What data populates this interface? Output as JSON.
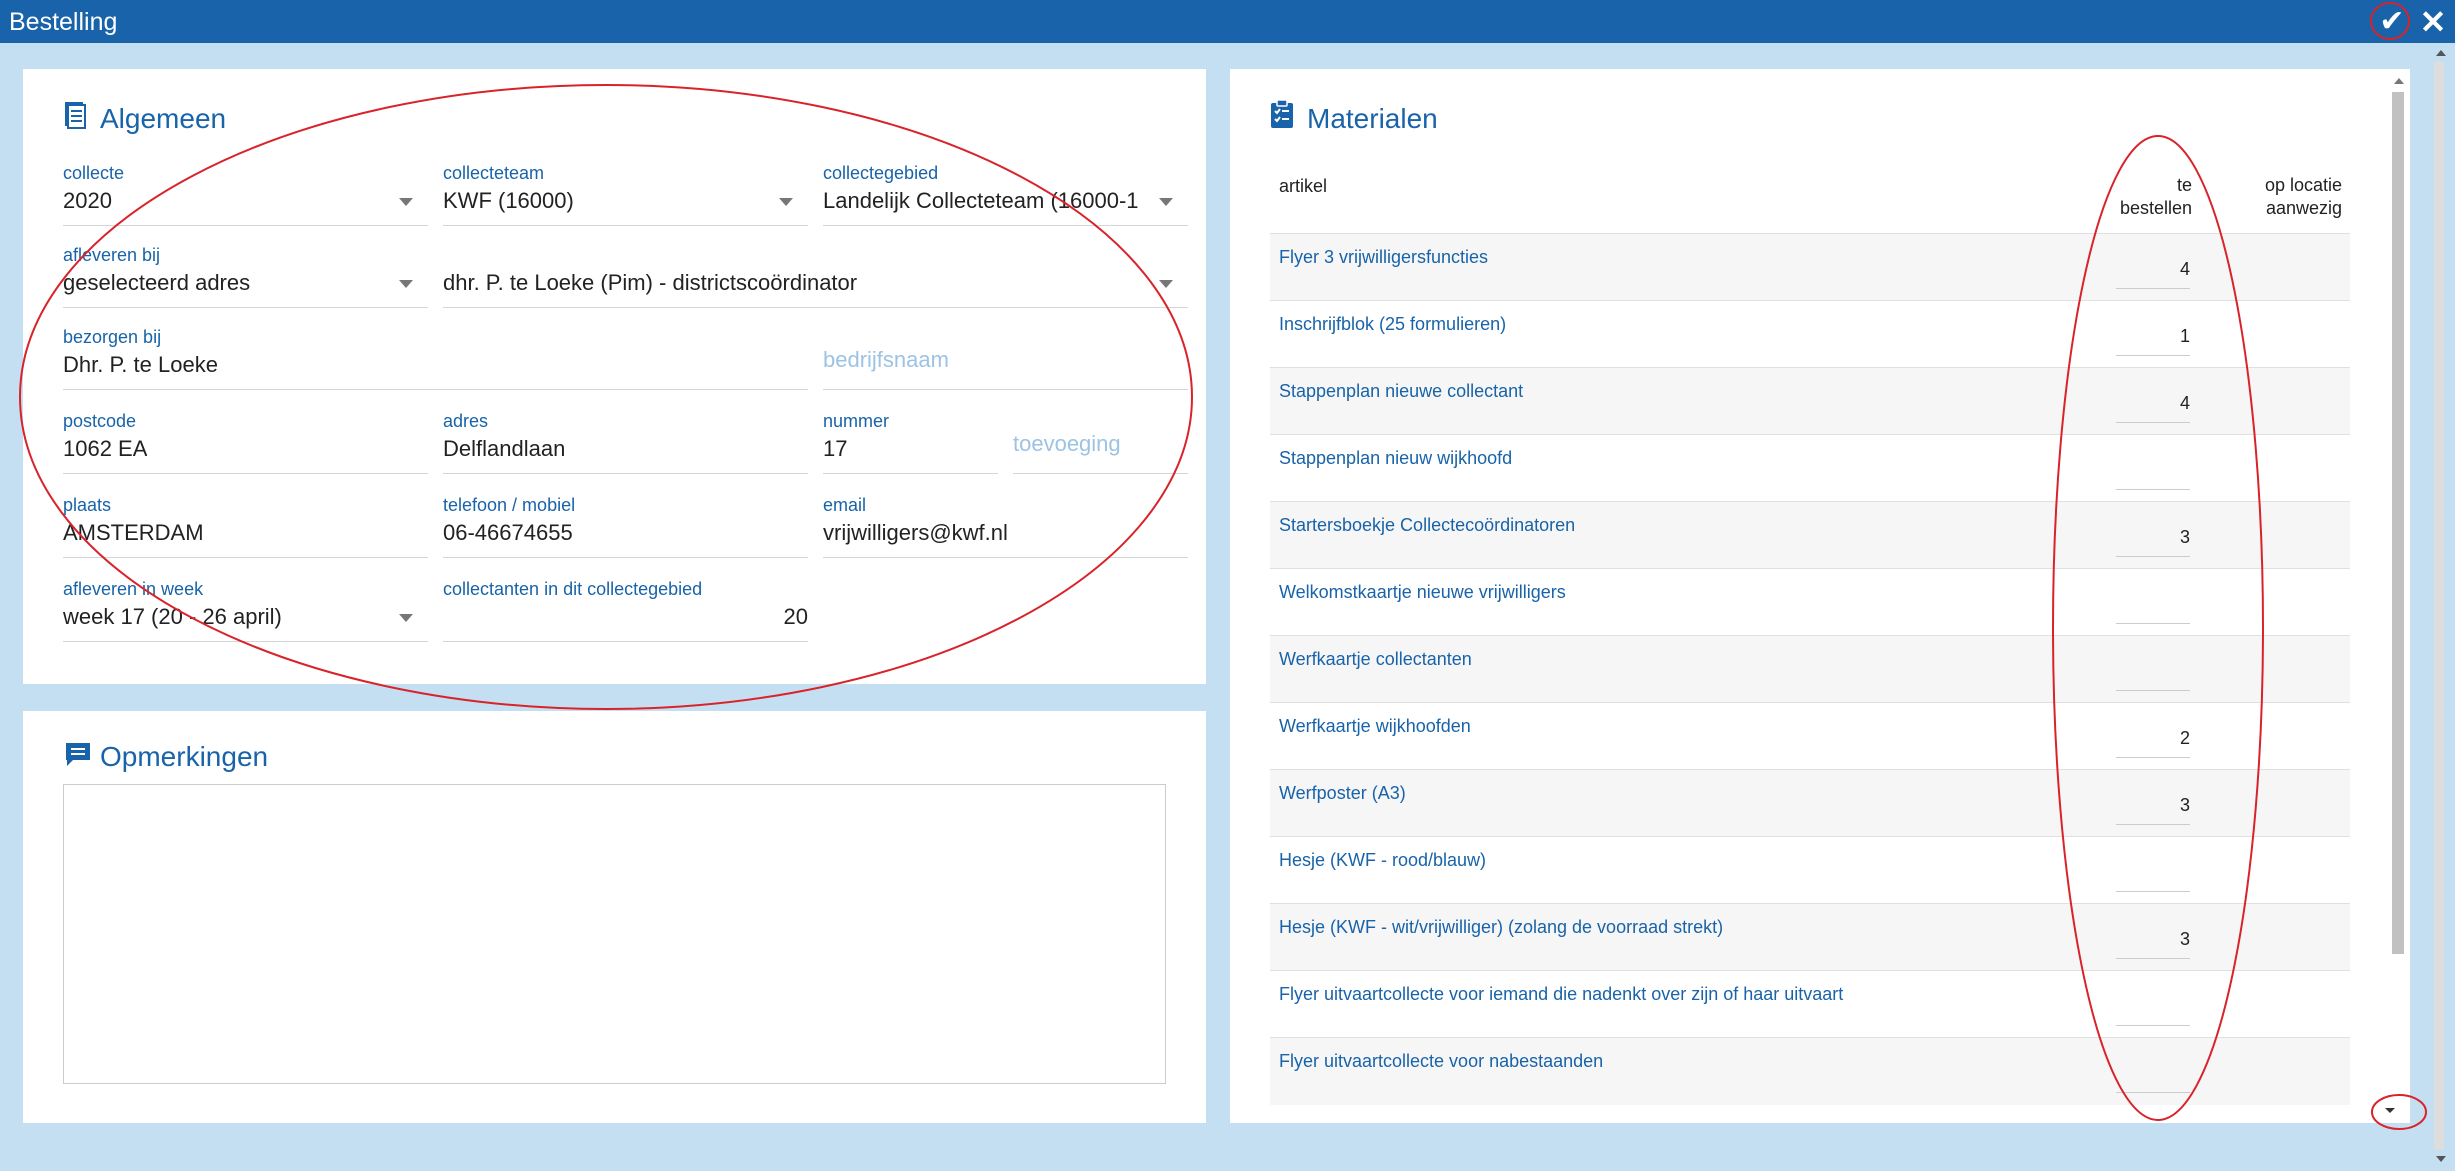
{
  "window": {
    "title": "Bestelling",
    "confirm_icon": "check-icon",
    "close_icon": "close-icon"
  },
  "algemeen": {
    "title": "Algemeen",
    "icon": "document-icon",
    "collecte": {
      "label": "collecte",
      "value": "2020"
    },
    "collecteteam": {
      "label": "collecteteam",
      "value": "KWF (16000)"
    },
    "collectegebied": {
      "label": "collectegebied",
      "value": "Landelijk Collecteteam (16000-1"
    },
    "afleveren_bij": {
      "label": "afleveren bij",
      "value": "geselecteerd adres"
    },
    "contact": {
      "value": "dhr. P. te Loeke (Pim) - districtscoördinator"
    },
    "bezorgen_bij": {
      "label": "bezorgen bij",
      "value": "Dhr. P. te Loeke"
    },
    "bedrijfsnaam": {
      "placeholder": "bedrijfsnaam"
    },
    "postcode": {
      "label": "postcode",
      "value": "1062 EA"
    },
    "adres": {
      "label": "adres",
      "value": "Delflandlaan"
    },
    "nummer": {
      "label": "nummer",
      "value": "17"
    },
    "toevoeging": {
      "placeholder": "toevoeging"
    },
    "plaats": {
      "label": "plaats",
      "value": "AMSTERDAM"
    },
    "telefoon": {
      "label": "telefoon / mobiel",
      "value": "06-46674655"
    },
    "email": {
      "label": "email",
      "value": "vrijwilligers@kwf.nl"
    },
    "afleveren_week": {
      "label": "afleveren in week",
      "value": "week 17 (20 - 26 april)"
    },
    "collectanten": {
      "label": "collectanten in dit collectegebied",
      "value": "20"
    }
  },
  "opmerkingen": {
    "title": "Opmerkingen",
    "icon": "comment-icon",
    "text": ""
  },
  "materialen": {
    "title": "Materialen",
    "icon": "clipboard-check-icon",
    "headers": {
      "artikel": "artikel",
      "te_bestellen_1": "te",
      "te_bestellen_2": "bestellen",
      "op_locatie_1": "op locatie",
      "op_locatie_2": "aanwezig"
    },
    "rows": [
      {
        "name": "Flyer 3 vrijwilligersfuncties",
        "qty": "4"
      },
      {
        "name": "Inschrijfblok (25 formulieren)",
        "qty": "1"
      },
      {
        "name": "Stappenplan nieuwe collectant",
        "qty": "4"
      },
      {
        "name": "Stappenplan nieuw wijkhoofd",
        "qty": ""
      },
      {
        "name": "Startersboekje Collectecoördinatoren",
        "qty": "3"
      },
      {
        "name": "Welkomstkaartje nieuwe vrijwilligers",
        "qty": ""
      },
      {
        "name": "Werfkaartje collectanten",
        "qty": ""
      },
      {
        "name": "Werfkaartje wijkhoofden",
        "qty": "2"
      },
      {
        "name": "Werfposter (A3)",
        "qty": "3"
      },
      {
        "name": "Hesje (KWF - rood/blauw)",
        "qty": ""
      },
      {
        "name": "Hesje (KWF - wit/vrijwilliger) (zolang de voorraad strekt)",
        "qty": "3"
      },
      {
        "name": "Flyer uitvaartcollecte voor iemand die nadenkt over zijn of haar uitvaart",
        "qty": ""
      },
      {
        "name": "Flyer uitvaartcollecte voor nabestaanden",
        "qty": ""
      }
    ]
  },
  "colors": {
    "brand": "#1863a9",
    "background": "#c5dff2",
    "annotation": "#d9232a"
  }
}
